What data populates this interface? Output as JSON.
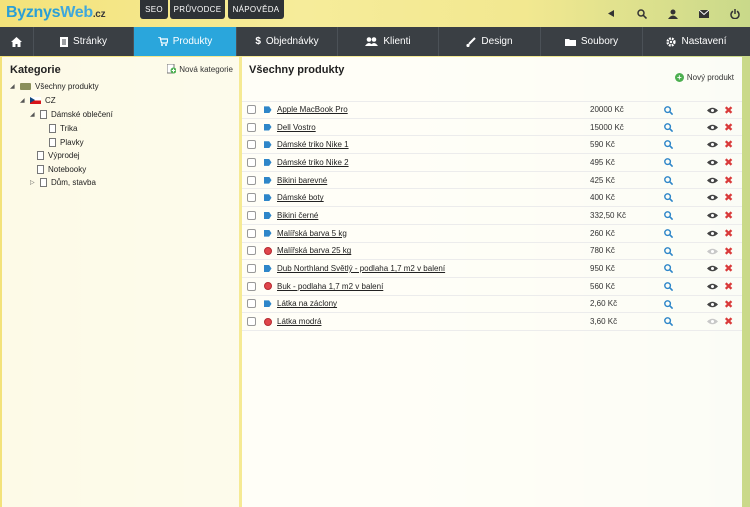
{
  "logo": {
    "part1": "Byznys",
    "part2": "Web",
    "part3": ".cz"
  },
  "top_buttons": [
    "SEO",
    "PRŮVODCE",
    "NÁPOVĚDA"
  ],
  "nav": {
    "home_icon": "home-icon",
    "items": [
      {
        "label": "Stránky",
        "icon": "pages-icon"
      },
      {
        "label": "Produkty",
        "icon": "cart-icon",
        "active": true
      },
      {
        "label": "Objednávky",
        "icon": "dollar-icon"
      },
      {
        "label": "Klienti",
        "icon": "users-icon"
      },
      {
        "label": "Design",
        "icon": "brush-icon"
      },
      {
        "label": "Soubory",
        "icon": "folder-icon"
      },
      {
        "label": "Nastavení",
        "icon": "gear-icon"
      }
    ]
  },
  "sidebar": {
    "title": "Kategorie",
    "new_category": "Nová kategorie",
    "tree": {
      "root": "Všechny produkty",
      "cz": "CZ",
      "womens": "Dámské oblečení",
      "tshirts": "Trika",
      "swimwear": "Plavky",
      "sale": "Výprodej",
      "notebooks": "Notebooky",
      "home": "Dům, stavba"
    }
  },
  "main": {
    "title": "Všechny produkty",
    "new_product": "Nový produkt",
    "products": [
      {
        "name": "Apple MacBook Pro",
        "price": "20000 Kč",
        "icon": "tag",
        "visible": true
      },
      {
        "name": "Dell Vostro",
        "price": "15000 Kč",
        "icon": "tag",
        "visible": true
      },
      {
        "name": "Dámské triko Nike 1",
        "price": "590 Kč",
        "icon": "tag",
        "visible": true
      },
      {
        "name": "Dámské triko Nike 2",
        "price": "495 Kč",
        "icon": "tag",
        "visible": true
      },
      {
        "name": "Bikini barevné",
        "price": "425 Kč",
        "icon": "tag",
        "visible": true
      },
      {
        "name": "Dámské boty",
        "price": "400 Kč",
        "icon": "tag",
        "visible": true
      },
      {
        "name": "Bikini černé",
        "price": "332,50 Kč",
        "icon": "tag",
        "visible": true
      },
      {
        "name": "Malířská barva 5 kg",
        "price": "260 Kč",
        "icon": "tag",
        "visible": true
      },
      {
        "name": "Malířská barva 25 kg",
        "price": "780 Kč",
        "icon": "stop",
        "visible": false
      },
      {
        "name": "Dub Northland Světlý - podlaha 1,7 m2 v balení",
        "price": "950 Kč",
        "icon": "tag",
        "visible": true
      },
      {
        "name": "Buk - podlaha 1,7 m2 v balení",
        "price": "560 Kč",
        "icon": "stop",
        "visible": true
      },
      {
        "name": "Látka na záclony",
        "price": "2,60 Kč",
        "icon": "tag",
        "visible": true
      },
      {
        "name": "Látka modrá",
        "price": "3,60 Kč",
        "icon": "stop",
        "visible": false
      }
    ]
  },
  "colors": {
    "accent": "#2aa6dc",
    "nav_bg": "#3a3f44",
    "delete": "#d93a3a"
  }
}
